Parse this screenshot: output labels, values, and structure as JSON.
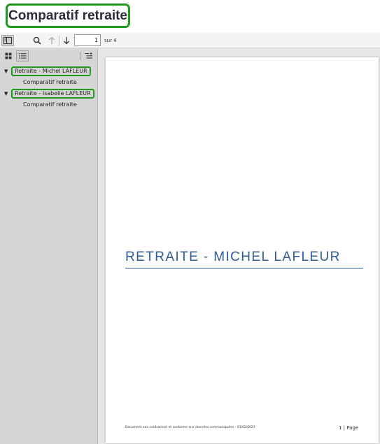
{
  "app": {
    "title": "Comparatif retraite"
  },
  "toolbar": {
    "current_page": "1",
    "page_total": "sur 4"
  },
  "sidebar": {
    "items": [
      {
        "label": "Retraite - Michel LAFLEUR",
        "children": [
          "Comparatif retraite"
        ]
      },
      {
        "label": "Retraite - Isabelle LAFLEUR",
        "children": [
          "Comparatif retraite"
        ]
      }
    ]
  },
  "document": {
    "title": "RETRAITE - MICHEL LAFLEUR",
    "footer_left": "Document non contractuel et conforme aux données communiquées - 01/02/2023",
    "footer_right": "1 | Page"
  },
  "colors": {
    "highlight_border": "#1f9a1f",
    "doc_title": "#2f5d9a",
    "sidebar_bg": "#d6d6d6"
  },
  "icons": [
    "sidebar-toggle-icon",
    "search-icon",
    "arrow-up-icon",
    "arrow-down-icon",
    "thumbnails-grid-icon",
    "outline-list-icon",
    "add-outline-icon"
  ]
}
